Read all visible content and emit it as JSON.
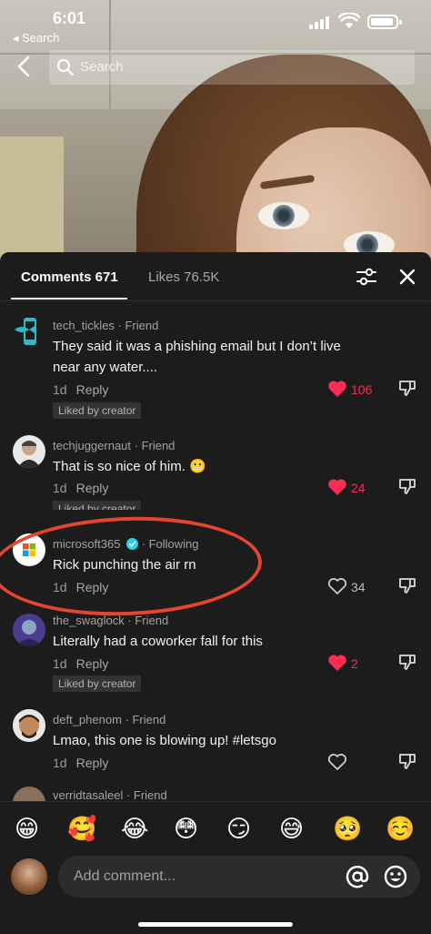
{
  "status_bar": {
    "time": "6:01",
    "back_label": "◂ Search"
  },
  "search": {
    "placeholder": "Search"
  },
  "tabs": [
    {
      "label": "Comments 671",
      "active": true
    },
    {
      "label": "Likes 76.5K",
      "active": false
    }
  ],
  "comments": [
    {
      "username": "tech_tickles",
      "relation": " · Friend",
      "text": "They said it was a phishing email but I don’t live near any water....",
      "age": "1d",
      "reply": "Reply",
      "likes": "106",
      "liked": true,
      "badge": "Liked by creator",
      "avatar_icon": "phone-fish-icon"
    },
    {
      "username": "techjuggernaut",
      "relation": " · Friend",
      "text": "That is so nice of him. 😬",
      "age": "1d",
      "reply": "Reply",
      "likes": "24",
      "liked": true,
      "badge": "Liked by creator",
      "avatar_icon": "person-avatar"
    },
    {
      "username": "microsoft365",
      "relation": " · Following",
      "verified": true,
      "text": "Rick punching the air rn",
      "age": "1d",
      "reply": "Reply",
      "likes": "34",
      "liked": false,
      "avatar_icon": "microsoft-logo"
    },
    {
      "username": "the_swaglock",
      "relation": " · Friend",
      "text": "Literally had a coworker fall for this",
      "age": "1d",
      "reply": "Reply",
      "likes": "2",
      "liked": true,
      "badge": "Liked by creator",
      "avatar_icon": "person-avatar"
    },
    {
      "username": "deft_phenom",
      "relation": " · Friend",
      "text": "Lmao, this one is blowing up! #letsgo",
      "age": "1d",
      "reply": "Reply",
      "likes": "",
      "liked": false,
      "avatar_icon": "memoji-avatar"
    },
    {
      "username": "verridtasaleel",
      "relation": " · Friend",
      "avatar_icon": "person-avatar"
    }
  ],
  "emoji_bar": [
    "😁",
    "🥰",
    "😂",
    "😳",
    "😏",
    "😅",
    "🥺",
    "☺️"
  ],
  "comment_input": {
    "placeholder": "Add comment..."
  },
  "colors": {
    "like_red": "#fe2c55",
    "sheet_bg": "#1c1c1c",
    "annotation_circle": "#e5442f"
  }
}
